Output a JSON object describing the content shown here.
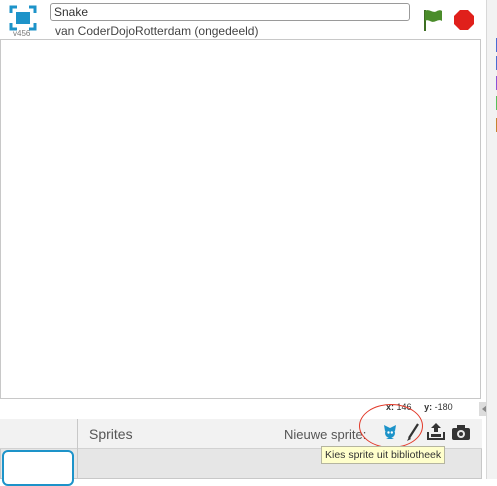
{
  "header": {
    "version": "v456",
    "title_value": "Snake",
    "owner_text": "van CoderDojoRotterdam (ongedeeld)"
  },
  "stage": {
    "x_label": "x:",
    "x_value": "146",
    "y_label": "y:",
    "y_value": "-180"
  },
  "sprite_pane": {
    "tab_label": "Sprites",
    "new_sprite_label": "Nieuwe sprite:",
    "tooltip": "Kies sprite uit bibliotheek"
  },
  "icons": {
    "fullscreen": "fullscreen-icon",
    "green_flag": "green-flag-icon",
    "stop": "stop-icon",
    "sprite_library": "sprite-library-icon",
    "paint": "paintbrush-icon",
    "upload": "upload-icon",
    "camera": "camera-icon"
  },
  "colors": {
    "accent": "#1d93c9",
    "flag": "#4a8c2a",
    "stop": "#e0201b",
    "highlight": "#e23a2a",
    "category_strip": [
      "#4a6cd4",
      "#8a55d7",
      "#59c059",
      "#c88330"
    ]
  }
}
